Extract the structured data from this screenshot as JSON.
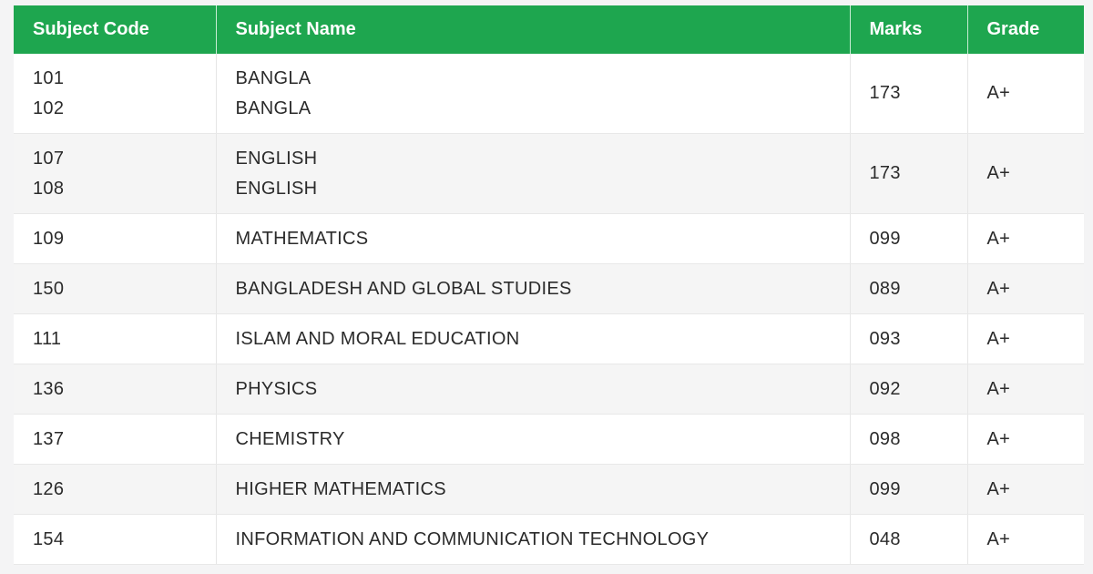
{
  "table": {
    "headers": [
      "Subject Code",
      "Subject Name",
      "Marks",
      "Grade"
    ],
    "rows": [
      {
        "codes": [
          "101",
          "102"
        ],
        "names": [
          "BANGLA",
          "BANGLA"
        ],
        "marks": "173",
        "grade": "A+"
      },
      {
        "codes": [
          "107",
          "108"
        ],
        "names": [
          "ENGLISH",
          "ENGLISH"
        ],
        "marks": "173",
        "grade": "A+"
      },
      {
        "codes": [
          "109"
        ],
        "names": [
          "MATHEMATICS"
        ],
        "marks": "099",
        "grade": "A+"
      },
      {
        "codes": [
          "150"
        ],
        "names": [
          "BANGLADESH AND GLOBAL STUDIES"
        ],
        "marks": "089",
        "grade": "A+"
      },
      {
        "codes": [
          "111"
        ],
        "names": [
          "ISLAM AND MORAL EDUCATION"
        ],
        "marks": "093",
        "grade": "A+"
      },
      {
        "codes": [
          "136"
        ],
        "names": [
          "PHYSICS"
        ],
        "marks": "092",
        "grade": "A+"
      },
      {
        "codes": [
          "137"
        ],
        "names": [
          "CHEMISTRY"
        ],
        "marks": "098",
        "grade": "A+"
      },
      {
        "codes": [
          "126"
        ],
        "names": [
          "HIGHER MATHEMATICS"
        ],
        "marks": "099",
        "grade": "A+"
      },
      {
        "codes": [
          "154"
        ],
        "names": [
          "INFORMATION AND COMMUNICATION TECHNOLOGY"
        ],
        "marks": "048",
        "grade": "A+"
      }
    ]
  },
  "colors": {
    "header_bg": "#1ea64f",
    "header_text": "#ffffff",
    "row_alt_bg": "#f5f5f5"
  }
}
